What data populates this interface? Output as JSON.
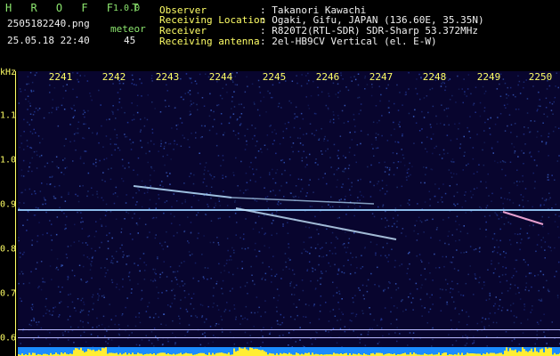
{
  "app": {
    "title": "H R O F F T",
    "version": "1.0.0"
  },
  "file": {
    "name": "2505182240.png",
    "datetime": "25.05.18 22:40"
  },
  "meteor": {
    "label": "meteor",
    "count": "45"
  },
  "info": {
    "observer_label": "Observer",
    "observer_value": ": Takanori Kawachi",
    "location_label": "Receiving Location",
    "location_value": ": Ogaki, Gifu, JAPAN (136.60E, 35.35N)",
    "receiver_label": "Receiver",
    "receiver_value": ": R820T2(RTL-SDR) SDR-Sharp 53.372MHz",
    "antenna_label": "Receiving antenna",
    "antenna_value": ": 2el-HB9CV Vertical (el. E-W)"
  },
  "axis": {
    "y_unit": "kHz",
    "x_ticks": [
      "2241",
      "2242",
      "2243",
      "2244",
      "2245",
      "2246",
      "2247",
      "2248",
      "2249",
      "2250"
    ],
    "y_ticks": [
      "1.1",
      "1.0",
      "0.9",
      "0.8",
      "0.7",
      "0.6"
    ]
  },
  "colors": {
    "label_green": "#8ce66e",
    "axis_yellow": "#ffff66",
    "background": "#08052e",
    "trace": "#9ad0ff"
  }
}
